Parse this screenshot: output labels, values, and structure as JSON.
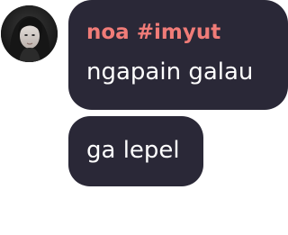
{
  "chat": {
    "sender": {
      "name": "noa #imyut",
      "name_color": "#f07c78",
      "avatar_icon": "user-avatar-photo"
    },
    "bubble_color": "#2a2837",
    "messages": [
      {
        "text": "ngapain galau"
      },
      {
        "text": "ga lepel"
      }
    ]
  }
}
